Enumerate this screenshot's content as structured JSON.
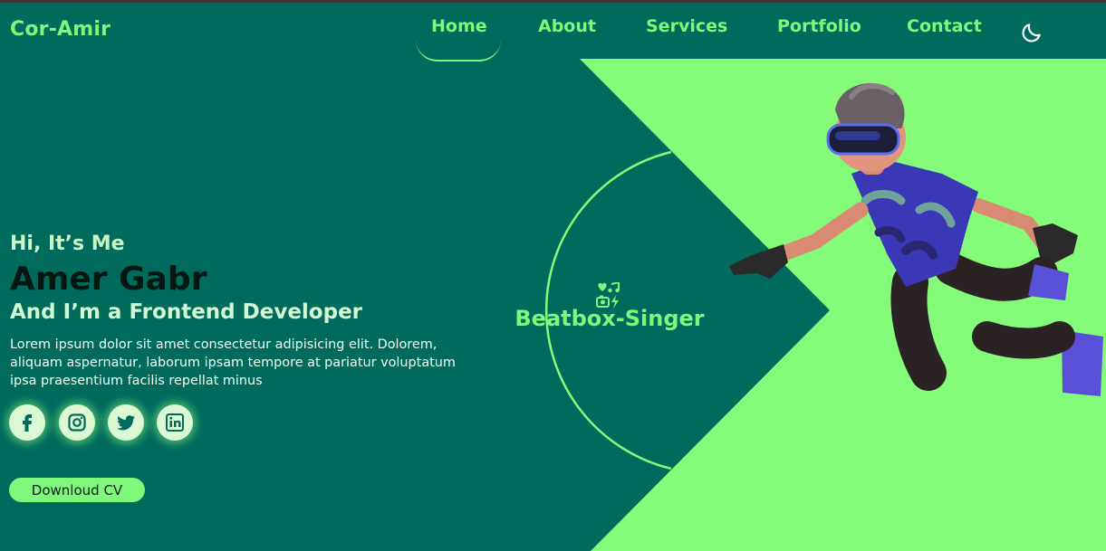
{
  "brand": {
    "logo": "Cor-Amir"
  },
  "nav": {
    "items": [
      "Home",
      "About",
      "Services",
      "Portfolio",
      "Contact"
    ],
    "active": "Home",
    "theme_toggle_icon": "moon-icon"
  },
  "hero": {
    "greeting": "Hi, It’s Me",
    "name": "Amer Gabr",
    "role": "And I’m a Frontend Developer",
    "description": "Lorem ipsum dolor sit amet consectetur adipisicing elit. Dolorem, aliquam aspernatur, laborum ipsam tempore at pariatur voluptatum ipsa praesentium facilis repellat minus",
    "cv_button": "Downloud CV"
  },
  "socials": [
    "facebook-icon",
    "instagram-icon",
    "twitter-icon",
    "linkedin-icon"
  ],
  "badge": {
    "label": "Beatbox-Singer",
    "icon": "music-camera-icon"
  },
  "colors": {
    "background": "#006a5d",
    "accent": "#7ff77a",
    "light": "#dbf8d2"
  }
}
